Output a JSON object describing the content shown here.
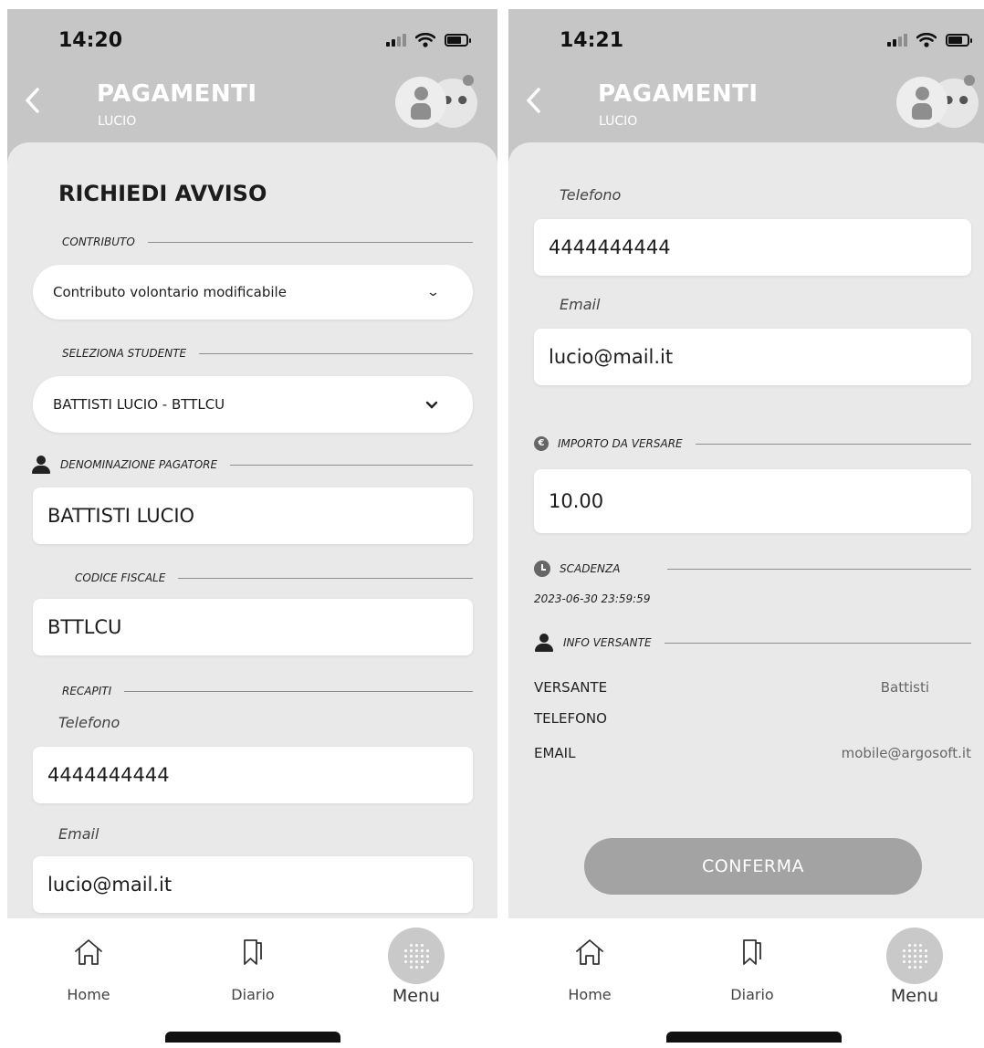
{
  "left": {
    "status": {
      "time": "14:20"
    },
    "header": {
      "title": "PAGAMENTI",
      "subtitle": "LUCIO",
      "avatar_badge": "••"
    },
    "heading": "RICHIEDI AVVISO",
    "contributo_section": "CONTRIBUTO",
    "contributo_value": "Contributo volontario modificabile",
    "studente_section": "SELEZIONA STUDENTE",
    "studente_value": "BATTISTI LUCIO - BTTLCU",
    "pagatore_section": "DENOMINAZIONE PAGATORE",
    "pagatore_value": "BATTISTI LUCIO",
    "cf_section": "CODICE FISCALE",
    "cf_value": "BTTLCU",
    "recapiti_section": "RECAPITI",
    "telefono_label": "Telefono",
    "telefono_value": "4444444444",
    "email_label": "Email",
    "email_value": "lucio@mail.it"
  },
  "right": {
    "status": {
      "time": "14:21"
    },
    "header": {
      "title": "PAGAMENTI",
      "subtitle": "LUCIO",
      "avatar_badge": "••"
    },
    "telefono_label": "Telefono",
    "telefono_value": "4444444444",
    "email_label": "Email",
    "email_value": "lucio@mail.it",
    "importo_section": "IMPORTO DA VERSARE",
    "importo_value": "10.00",
    "scadenza_section": "SCADENZA",
    "scadenza_value": "2023-06-30 23:59:59",
    "info_section": "INFO VERSANTE",
    "versante_label": "VERSANTE",
    "versante_value": "Battisti",
    "telefono_row_label": "TELEFONO",
    "email_row_label": "EMAIL",
    "email_row_value": "mobile@argosoft.it",
    "confirm_label": "CONFERMA"
  },
  "tabs": {
    "home": "Home",
    "diario": "Diario",
    "menu": "Menu"
  },
  "icons": {
    "back": "chevron-left-icon",
    "home": "home-icon",
    "diario": "bookmark-icon",
    "menu": "dot-grid-icon"
  },
  "colors": {
    "header_bg": "#c6c6c6",
    "sheet_bg": "#e9e9e9",
    "button_bg": "#a3a3a3"
  }
}
